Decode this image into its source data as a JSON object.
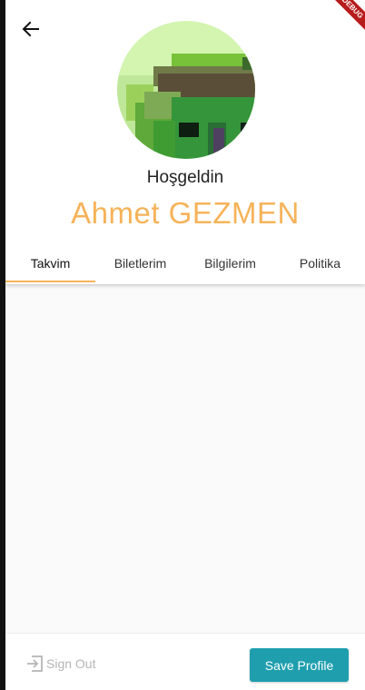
{
  "header": {
    "welcome": "Hoşgeldin",
    "name": "Ahmet GEZMEN",
    "debug_label": "DEBUG",
    "back_icon": "arrow-left-icon",
    "name_color": "#f6b35a"
  },
  "tabs": [
    {
      "label": "Takvim",
      "active": true
    },
    {
      "label": "Biletlerim",
      "active": false
    },
    {
      "label": "Bilgilerim",
      "active": false
    },
    {
      "label": "Politika",
      "active": false
    }
  ],
  "footer": {
    "sign_out": "Sign Out",
    "sign_out_icon": "exit-icon",
    "save": "Save Profile",
    "save_color": "#1f9fae"
  }
}
